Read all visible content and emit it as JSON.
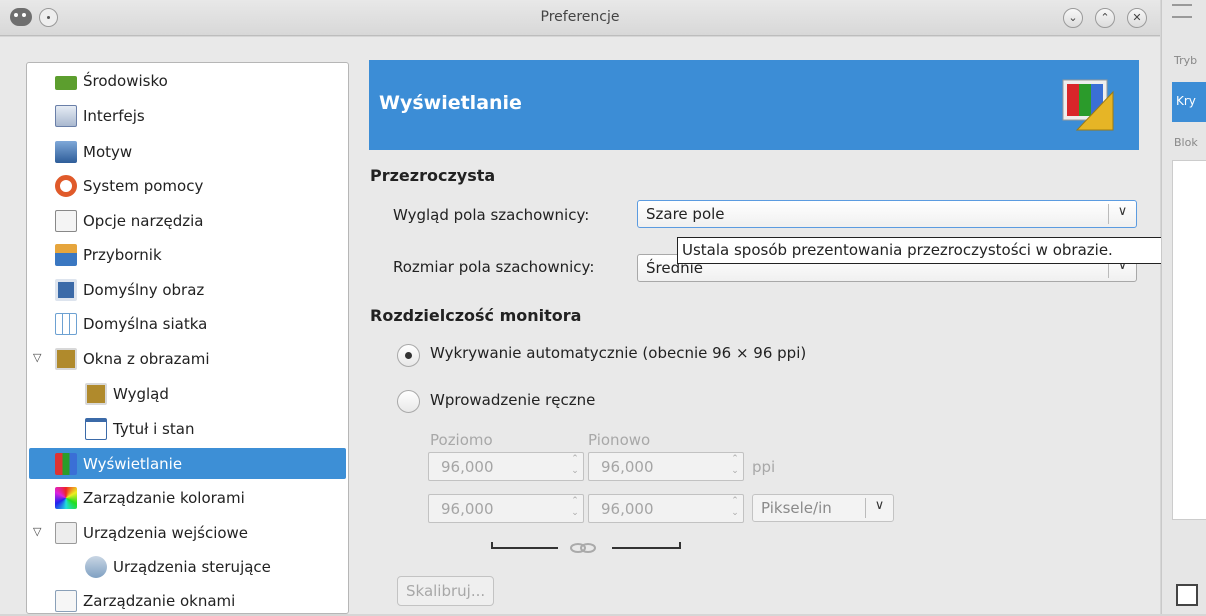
{
  "window": {
    "title": "Preferencje",
    "buttons": [
      "minimize",
      "maximize",
      "close"
    ]
  },
  "sidebar": {
    "items": [
      {
        "label": "Środowisko",
        "icon": "memory-chip-icon",
        "color": "#5c9e2e"
      },
      {
        "label": "Interfejs",
        "icon": "interface-icon",
        "color": "#6a7fa8"
      },
      {
        "label": "Motyw",
        "icon": "theme-icon",
        "color": "#3a6ca8"
      },
      {
        "label": "System pomocy",
        "icon": "lifebuoy-icon",
        "color": "#e05a2a"
      },
      {
        "label": "Opcje narzędzia",
        "icon": "tool-options-icon",
        "color": "#888888"
      },
      {
        "label": "Przybornik",
        "icon": "toolbox-icon",
        "color": "#3a77c1"
      },
      {
        "label": "Domyślny obraz",
        "icon": "image-icon",
        "color": "#3b6aa8"
      },
      {
        "label": "Domyślna siatka",
        "icon": "grid-icon",
        "color": "#6da1d2"
      },
      {
        "label": "Okna z obrazami",
        "icon": "image-windows-icon",
        "color": "#b08a2c",
        "expanded": true
      },
      {
        "label": "Wygląd",
        "icon": "appearance-icon",
        "color": "#b08a2c",
        "child": true
      },
      {
        "label": "Tytuł i stan",
        "icon": "title-status-icon",
        "color": "#c73b3b",
        "child": true
      },
      {
        "label": "Wyświetlanie",
        "icon": "display-icon",
        "color": "#e0a31e",
        "selected": true
      },
      {
        "label": "Zarządzanie kolorami",
        "icon": "color-management-icon",
        "color": "#c8308f"
      },
      {
        "label": "Urządzenia wejściowe",
        "icon": "input-devices-icon",
        "color": "#9a9a9a",
        "expanded": true
      },
      {
        "label": "Urządzenia sterujące",
        "icon": "controllers-icon",
        "color": "#7fa0c2",
        "child": true
      },
      {
        "label": "Zarządzanie oknami",
        "icon": "window-management-icon",
        "color": "#8aa0b8"
      }
    ]
  },
  "panel": {
    "title": "Wyświetlanie",
    "transparency": {
      "heading": "Przezroczysta",
      "check_style_label": "Wygląd pola szachownicy:",
      "check_style_value": "Szare pole",
      "check_size_label": "Rozmiar pola szachownicy:",
      "check_size_value": "Średnie",
      "tooltip": "Ustala sposób prezentowania przezroczystości w obrazie."
    },
    "monitor": {
      "heading": "Rozdzielczość monitora",
      "auto_label": "Wykrywanie automatycznie (obecnie 96 × 96 ppi)",
      "manual_label": "Wprowadzenie ręczne",
      "horizontal_label": "Poziomo",
      "vertical_label": "Pionowo",
      "res_x": "96,000",
      "res_y": "96,000",
      "unit_ppi": "ppi",
      "res_x2": "96,000",
      "res_y2": "96,000",
      "unit_select": "Piksele/in",
      "calibrate": "Skalibruj..."
    }
  },
  "right_panel": {
    "labels": [
      "Tryb",
      "Kry",
      "Blok"
    ],
    "accent": "#3c8dd6"
  }
}
